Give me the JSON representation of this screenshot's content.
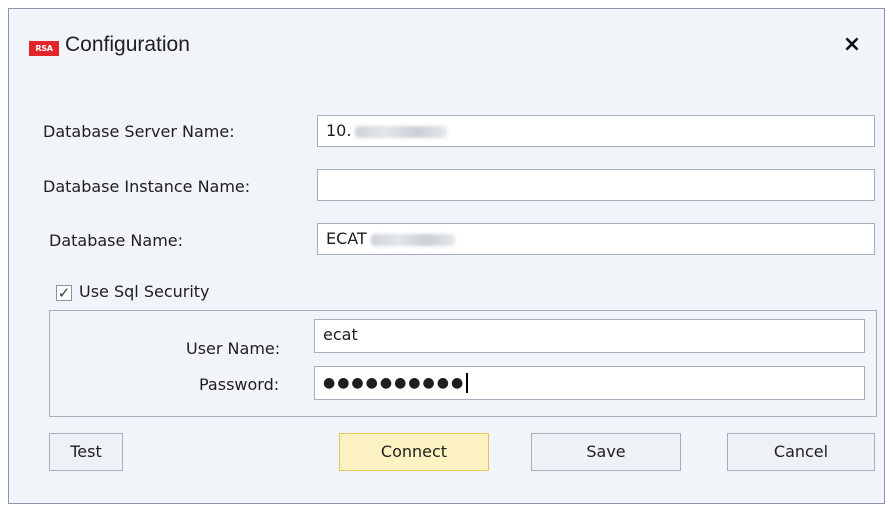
{
  "window": {
    "title": "Configuration",
    "logo_text": "RSA",
    "close_glyph": "×"
  },
  "form": {
    "server_label": "Database Server Name:",
    "server_value": "10.",
    "instance_label": "Database Instance Name:",
    "instance_value": "",
    "dbname_label": "Database Name:",
    "dbname_value": "ECAT",
    "use_sql_security_label": "Use Sql Security",
    "use_sql_security_checked": true,
    "check_glyph": "✓",
    "username_label": "User Name:",
    "username_value": "ecat",
    "password_label": "Password:",
    "password_mask": "●●●●●●●●●●"
  },
  "buttons": {
    "test": "Test",
    "connect": "Connect",
    "save": "Save",
    "cancel": "Cancel"
  },
  "colors": {
    "accent_logo": "#e3262b",
    "primary_button_bg": "#fdf3c2",
    "window_bg": "#f1f4f9"
  }
}
